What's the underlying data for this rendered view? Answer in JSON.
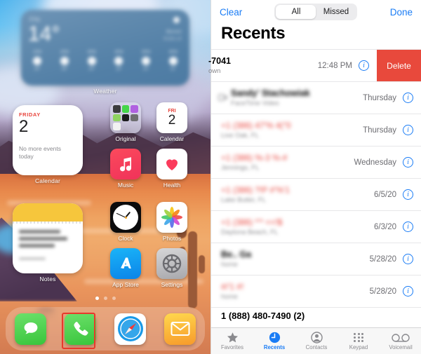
{
  "home_screen": {
    "weather_widget": {
      "label": "Weather",
      "city": "City",
      "temperature": "14°",
      "condition": "Blurred",
      "detail": "H:14 L:4",
      "sun_icon": "sun-icon",
      "hours": [
        {
          "hour": "1PM",
          "temp": "14°"
        },
        {
          "hour": "2PM",
          "temp": "14°"
        },
        {
          "hour": "3PM",
          "temp": "13°"
        },
        {
          "hour": "4PM",
          "temp": "13°"
        },
        {
          "hour": "5PM",
          "temp": "12°"
        },
        {
          "hour": "6PM",
          "temp": "11°"
        }
      ]
    },
    "calendar_widget": {
      "label": "Calendar",
      "weekday": "FRIDAY",
      "day_number": "2",
      "message": "No more events today"
    },
    "notes_widget": {
      "label": "Notes",
      "body_blurred": "Sometimes you realize that true love is far absolute for...",
      "footer_blurred": "Yesterday"
    },
    "apps": [
      {
        "name": "Original",
        "icon": "folder-icon"
      },
      {
        "name": "Calendar",
        "icon": "calendar-icon",
        "weekday": "FRI",
        "day": "2"
      },
      {
        "name": "Music",
        "icon": "music-note-icon"
      },
      {
        "name": "Health",
        "icon": "heart-icon"
      },
      {
        "name": "Clock",
        "icon": "clock-icon"
      },
      {
        "name": "Photos",
        "icon": "photos-pinwheel-icon"
      },
      {
        "name": "App Store",
        "icon": "app-store-icon"
      },
      {
        "name": "Settings",
        "icon": "gear-icon"
      }
    ],
    "page_dots": {
      "count": 3,
      "active_index": 0
    },
    "dock": [
      {
        "name": "Messages",
        "icon": "message-bubble-icon",
        "highlighted": false
      },
      {
        "name": "Phone",
        "icon": "phone-handset-icon",
        "highlighted": true
      },
      {
        "name": "Safari",
        "icon": "compass-icon",
        "highlighted": false
      },
      {
        "name": "Mail",
        "icon": "envelope-icon",
        "highlighted": false
      }
    ],
    "highlight_color": "#e8392b"
  },
  "phone_app": {
    "nav": {
      "clear_label": "Clear",
      "done_label": "Done",
      "segments": [
        {
          "label": "All",
          "selected": true
        },
        {
          "label": "Missed",
          "selected": false
        }
      ]
    },
    "page_title": "Recents",
    "accent_color": "#1a7cf5",
    "delete_color": "#e8493c",
    "missed_call_color": "#e8443c",
    "calls": [
      {
        "name": "-7041",
        "sub": "own",
        "time": "12:48 PM",
        "type": "swiped",
        "blurred": false,
        "missed": false,
        "delete_label": "Delete"
      },
      {
        "name": "Sandy' Stachowiak",
        "sub": "FaceTime Video",
        "time": "Thursday",
        "type": "facetime-video",
        "blurred": true,
        "missed": false
      },
      {
        "name": "+1 (386) 47'% 4(\"0",
        "sub": "Live Oak, FL",
        "time": "Thursday",
        "type": "call",
        "blurred": true,
        "missed": true
      },
      {
        "name": "+1 (386) %-3 %-#",
        "sub": "Jennings, FL",
        "time": "Wednesday",
        "type": "call",
        "blurred": true,
        "missed": true
      },
      {
        "name": "+1 (386) ?!P #'%'1",
        "sub": "Lake Butler, FL",
        "time": "6/5/20",
        "type": "call",
        "blurred": true,
        "missed": true
      },
      {
        "name": "+1 (386) *'* <<!$",
        "sub": "Daytona Beach, FL",
        "time": "6/3/20",
        "type": "call",
        "blurred": true,
        "missed": true
      },
      {
        "name": "Be.. Ga",
        "sub": "home",
        "time": "5/28/20",
        "type": "call",
        "blurred": true,
        "missed": false
      },
      {
        "name": "#/'1 #!",
        "sub": "home",
        "time": "5/28/20",
        "type": "call",
        "blurred": true,
        "missed": true
      }
    ],
    "partial_row": {
      "name": "1 (888) 480-7490 (2)"
    },
    "tabs": [
      {
        "label": "Favorites",
        "icon": "star-icon",
        "active": false
      },
      {
        "label": "Recents",
        "icon": "clock-icon",
        "active": true
      },
      {
        "label": "Contacts",
        "icon": "person-circle-icon",
        "active": false
      },
      {
        "label": "Keypad",
        "icon": "keypad-dots-icon",
        "active": false
      },
      {
        "label": "Voicemail",
        "icon": "voicemail-icon",
        "active": false
      }
    ]
  }
}
